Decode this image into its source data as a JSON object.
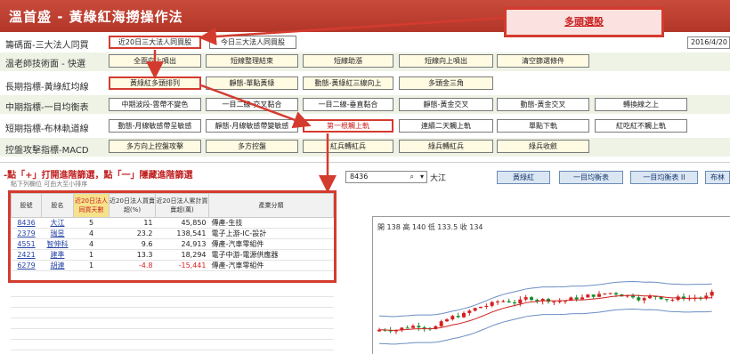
{
  "app": {
    "title": "溫首盛 - 黃綠紅海撈操作法",
    "top_button": "多頭選股",
    "date": "2016/4/20"
  },
  "rows": [
    {
      "label": "籌碼面-三大法人同買",
      "buttons": [
        "近20日三大法人同買股",
        "今日三大法人同買股"
      ]
    },
    {
      "label": "溫老師技術面 - 快選",
      "buttons": [
        "全面向上噴出",
        "短線整理結束",
        "短線助漲",
        "短線向上噴出",
        "清空篩選條件"
      ]
    },
    {
      "label": "長期指標-黃綠紅均線",
      "buttons": [
        "黃綠紅多頭排列",
        "靜態-單點黃綠",
        "動態-黃綠紅三線向上",
        "多頭金三角"
      ]
    },
    {
      "label": "中期指標-一目均衡表",
      "buttons": [
        "中期波段-雲帶不變色",
        "一目二線-交叉黏合",
        "一目二線-垂直黏合",
        "靜態-黃金交叉",
        "動態-黃金交叉",
        "轉換線之上"
      ]
    },
    {
      "label": "短期指標-布林軌道線",
      "buttons": [
        "動態-月線敏感帶呈敏感",
        "靜態-月線敏感帶變敏感",
        "第一根觸上軌",
        "連續二天觸上軌",
        "單點下軌",
        "紅吃紅不觸上軌"
      ]
    },
    {
      "label": "控盤攻擊指標-MACD",
      "buttons": [
        "多方向上控盤攻擊",
        "多方控盤",
        "紅兵轉紅兵",
        "綠兵轉紅兵",
        "綠兵收斂"
      ]
    }
  ],
  "hint": {
    "line1": "-點「+」打開進階篩選，點「一」隱藏進階篩選",
    "line2": "點下列欄位 可由大至小排序"
  },
  "stock": {
    "code": "8436",
    "name": "大江",
    "tabs": [
      "黃綠紅",
      "一目均衡表",
      "一目均衡表 II",
      "布林"
    ]
  },
  "table": {
    "headers": [
      "股號",
      "股名",
      "近20日法人同買天數",
      "近20日法人買賣超(%)",
      "近20日法人累計買賣超(萬)",
      "產業分類"
    ],
    "rows": [
      {
        "code": "8436",
        "name": "大江",
        "days": "5",
        "pct": "11",
        "amt": "45,850",
        "ind": "傳產-生技"
      },
      {
        "code": "2379",
        "name": "瑞昱",
        "days": "4",
        "pct": "23.2",
        "amt": "138,541",
        "ind": "電子上游-IC-設計"
      },
      {
        "code": "4551",
        "name": "智伸科",
        "days": "4",
        "pct": "9.6",
        "amt": "24,913",
        "ind": "傳產-汽車零組件"
      },
      {
        "code": "2421",
        "name": "建準",
        "days": "1",
        "pct": "13.3",
        "amt": "18,294",
        "ind": "電子中游-電源供應器"
      },
      {
        "code": "6279",
        "name": "胡連",
        "days": "1",
        "pct": "-4.8",
        "amt": "-15,441",
        "ind": "傳產-汽車零組件"
      }
    ]
  },
  "chart_info": "開 138 高 140 低 133.5 收 134",
  "colors": {
    "title_bg": "#c23e2f",
    "highlight": "#d43b2f",
    "up": "#d42020",
    "down": "#1a8a2a",
    "ma": "#c22"
  },
  "icons": {
    "dropdown": "chevron-down-icon",
    "search": "search-icon"
  },
  "chart_data": {
    "type": "candlestick",
    "title": "",
    "ohlc_latest": {
      "open": 138,
      "high": 140,
      "low": 133.5,
      "close": 134
    }
  }
}
